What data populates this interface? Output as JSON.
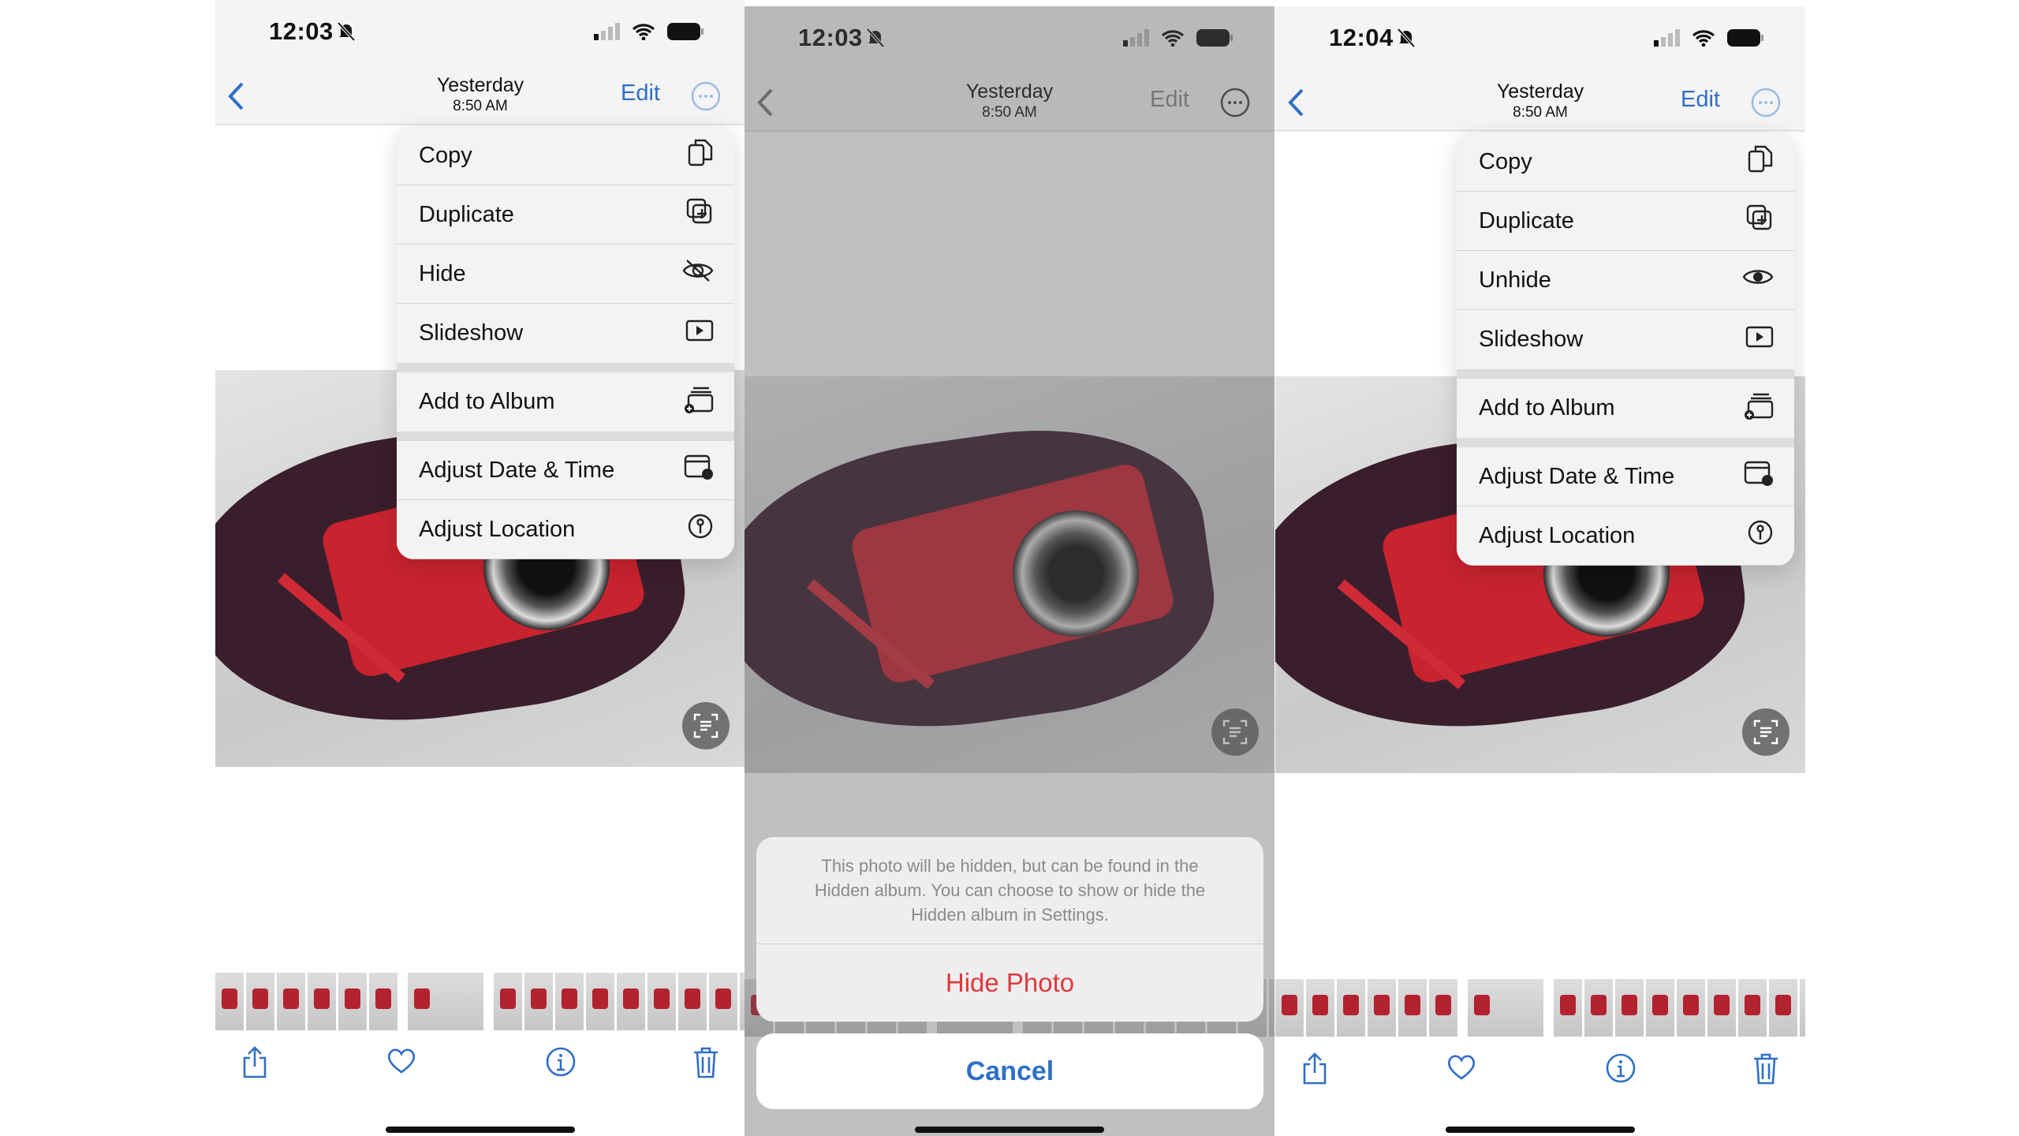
{
  "colors": {
    "accent": "#2f6fc6",
    "destructive": "#e0383b"
  },
  "panels": [
    {
      "time": "12:03",
      "title": "Yesterday",
      "subtitle": "8:50 AM",
      "edit": "Edit",
      "dimmed": false,
      "menu": [
        {
          "label": "Copy",
          "icon": "copy-icon"
        },
        {
          "label": "Duplicate",
          "icon": "duplicate-icon"
        },
        {
          "label": "Hide",
          "icon": "eye-slash-icon"
        },
        {
          "label": "Slideshow",
          "icon": "play-icon",
          "gap": true
        },
        {
          "label": "Add to Album",
          "icon": "add-to-album-icon",
          "gap": true
        },
        {
          "label": "Adjust Date & Time",
          "icon": "calendar-clock-icon"
        },
        {
          "label": "Adjust Location",
          "icon": "location-pin-icon"
        }
      ]
    },
    {
      "time": "12:03",
      "title": "Yesterday",
      "subtitle": "8:50 AM",
      "edit": "Edit",
      "dimmed": true,
      "sheet": {
        "message": "This photo will be hidden, but can be found in the Hidden album. You can choose to show or hide the Hidden album in Settings.",
        "action": "Hide Photo",
        "cancel": "Cancel"
      }
    },
    {
      "time": "12:04",
      "title": "Yesterday",
      "subtitle": "8:50 AM",
      "edit": "Edit",
      "dimmed": false,
      "menu": [
        {
          "label": "Copy",
          "icon": "copy-icon"
        },
        {
          "label": "Duplicate",
          "icon": "duplicate-icon"
        },
        {
          "label": "Unhide",
          "icon": "eye-icon"
        },
        {
          "label": "Slideshow",
          "icon": "play-icon",
          "gap": true
        },
        {
          "label": "Add to Album",
          "icon": "add-to-album-icon",
          "gap": true
        },
        {
          "label": "Adjust Date & Time",
          "icon": "calendar-clock-icon"
        },
        {
          "label": "Adjust Location",
          "icon": "location-pin-icon"
        }
      ]
    }
  ],
  "toolbar": [
    {
      "icon": "share-icon"
    },
    {
      "icon": "heart-icon"
    },
    {
      "icon": "info-icon"
    },
    {
      "icon": "trash-icon"
    }
  ]
}
